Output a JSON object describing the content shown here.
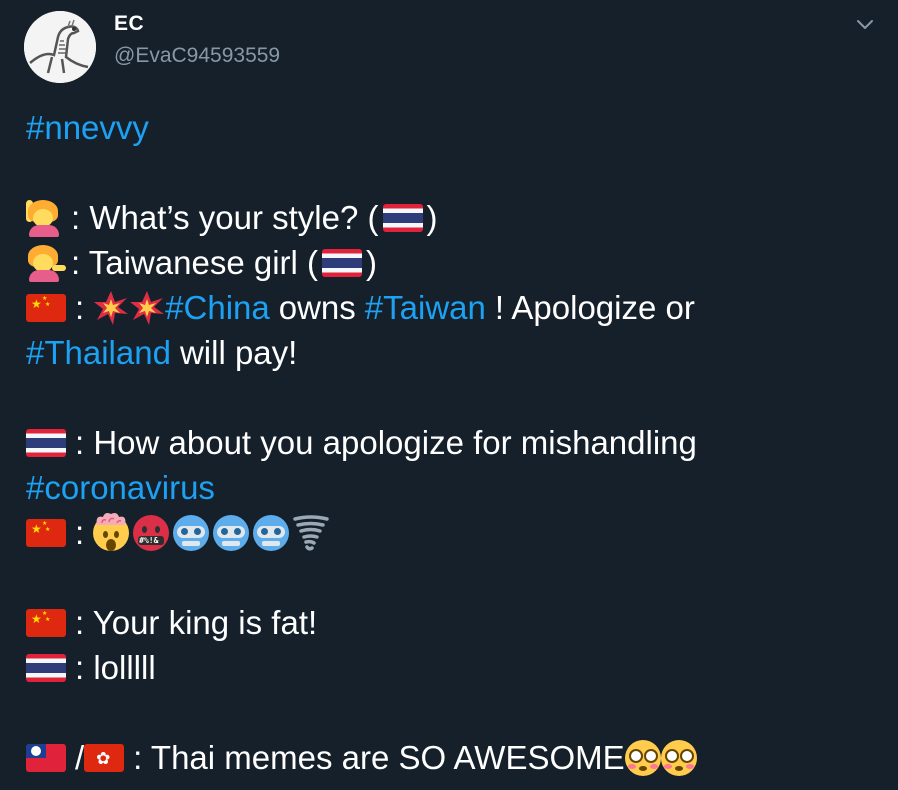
{
  "author": {
    "display_name": "EC",
    "handle": "@EvaC94593559",
    "avatar": "dinosaur-skeleton-avatar"
  },
  "menu_icon": "chevron-down-icon",
  "colors": {
    "background": "#15202b",
    "text": "#ffffff",
    "hashtag": "#1da1f2",
    "secondary_text": "#8899a6"
  },
  "tweet": {
    "line1": {
      "hashtag": "#nnevvy"
    },
    "line2": {
      "emoji": "person-raising-hand",
      "text_a": ": What’s your style? (",
      "flag": "thailand-flag",
      "text_b": ")"
    },
    "line3": {
      "emoji": "person-tipping-hand",
      "text_a": ": Taiwanese girl (",
      "flag": "thailand-flag",
      "text_b": ")"
    },
    "line4": {
      "flag": "china-flag",
      "colon": ":",
      "emojis": [
        "collision",
        "collision"
      ],
      "hashtag1": "#China",
      "mid": "owns",
      "hashtag2": "#Taiwan",
      "end": "! Apologize or"
    },
    "line5": {
      "hashtag": "#Thailand",
      "end": "will pay!"
    },
    "line6": {
      "flag": "thailand-flag",
      "text": ": How about you apologize for mishandling"
    },
    "line7": {
      "hashtag": "#coronavirus"
    },
    "line8": {
      "flag": "china-flag",
      "colon": ":",
      "emojis": [
        "exploding-head",
        "face-with-symbols-on-mouth",
        "robot",
        "robot",
        "robot",
        "tornado"
      ],
      "symbols": "#%!&"
    },
    "line9": {
      "flag": "china-flag",
      "text": ": Your king is fat!"
    },
    "line10": {
      "flag": "thailand-flag",
      "text": ": lolllll"
    },
    "line11": {
      "flag1": "taiwan-flag",
      "slash": "/",
      "flag2": "hong-kong-flag",
      "text": ": Thai memes are SO AWESOME",
      "emojis": [
        "flushed-face",
        "flushed-face"
      ]
    }
  }
}
